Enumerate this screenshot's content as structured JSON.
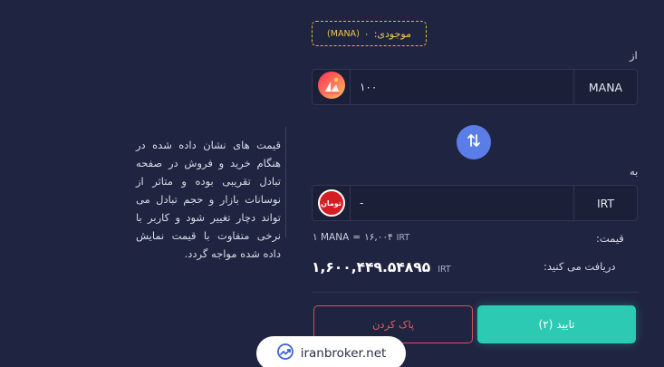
{
  "balance": {
    "label": "موجودی:",
    "value": "۰",
    "unit": "(MANA)"
  },
  "from": {
    "label": "از",
    "amount": "۱۰۰",
    "ticker": "MANA",
    "icon": "decentraland-icon"
  },
  "to": {
    "label": "به",
    "amount": "-",
    "ticker": "IRT",
    "icon": "toman-icon",
    "icon_text": "تومان"
  },
  "swap": {
    "icon": "swap-arrows-icon"
  },
  "price": {
    "label": "قیمت:",
    "base": "۱ MANA",
    "eq": "=",
    "value": "۱۶,۰۰۴",
    "unit": "IRT"
  },
  "receive": {
    "label": "دریافت می کنید:",
    "value": "۱,۶۰۰,۴۴۹.۵۴۸۹۵",
    "unit": "IRT"
  },
  "buttons": {
    "clear": "پاک کردن",
    "confirm": "تایید (۲)"
  },
  "note": "قیمت های نشان داده شده در هنگام خرید و فروش در صفحه تبادل تقریبی بوده و متاثر از نوسانات بازار و حجم تبادل می تواند دچار تغییر شود و کاربر با نرخی متفاوت با قیمت نمایش داده شده مواجه گردد.",
  "watermark": {
    "text": "iranbroker.net"
  },
  "colors": {
    "background": "#1f2540",
    "accent": "#2cc9b3",
    "danger": "#e24b55",
    "balance": "#f2c74a",
    "swap": "#5a7de8"
  }
}
